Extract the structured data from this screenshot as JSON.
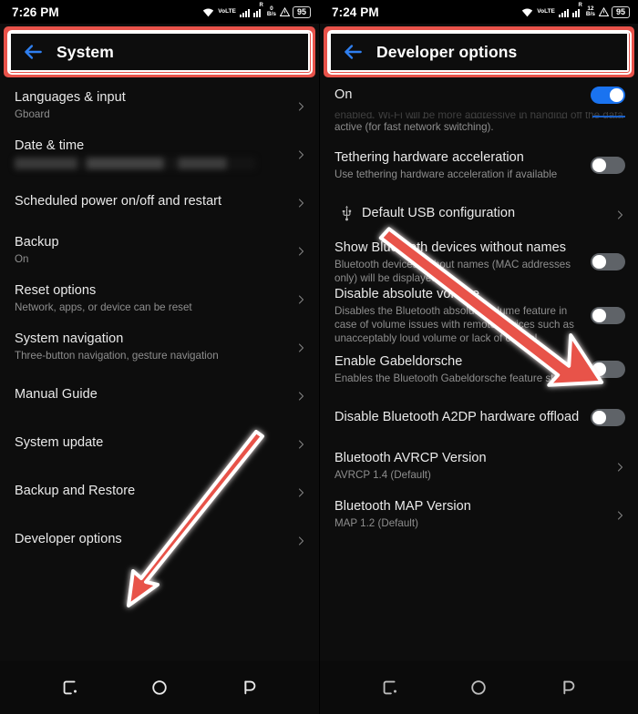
{
  "left_screen": {
    "status_bar": {
      "time": "7:26 PM",
      "volte_label_top": "Vo",
      "volte_label_bottom": "LTE",
      "roaming_label": "R",
      "net_speed_value": "0",
      "net_speed_unit": "B/s",
      "battery_level": "95",
      "icons": [
        "wifi-icon",
        "volte-icon",
        "signal-bars-icon",
        "roaming-signal-icon",
        "network-speed-icon",
        "alert-triangle-icon",
        "battery-icon"
      ]
    },
    "title": "System",
    "back_icon": "back-arrow-icon",
    "items": [
      {
        "title": "Languages & input",
        "subtitle": "Gboard",
        "accessory": "chevron"
      },
      {
        "title": "Date & time",
        "subtitle": "",
        "subtitle_redacted": true,
        "accessory": "chevron"
      },
      {
        "title": "Scheduled power on/off and restart",
        "subtitle": "",
        "accessory": "chevron"
      },
      {
        "title": "Backup",
        "subtitle": "On",
        "accessory": "chevron"
      },
      {
        "title": "Reset options",
        "subtitle": "Network, apps, or device can be reset",
        "accessory": "chevron"
      },
      {
        "title": "System navigation",
        "subtitle": "Three-button navigation, gesture navigation",
        "accessory": "chevron"
      },
      {
        "title": "Manual Guide",
        "subtitle": "",
        "accessory": "chevron"
      },
      {
        "title": "System update",
        "subtitle": "",
        "accessory": "chevron"
      },
      {
        "title": "Backup and Restore",
        "subtitle": "",
        "accessory": "chevron"
      },
      {
        "title": "Developer options",
        "subtitle": "",
        "accessory": "chevron"
      }
    ],
    "nav_bar": [
      "recents-button",
      "home-button",
      "back-button"
    ]
  },
  "right_screen": {
    "status_bar": {
      "time": "7:24 PM",
      "volte_label_top": "Vo",
      "volte_label_bottom": "LTE",
      "roaming_label": "R",
      "net_speed_value": "12",
      "net_speed_unit": "B/s",
      "battery_level": "95",
      "icons": [
        "wifi-icon",
        "volte-icon",
        "signal-bars-icon",
        "roaming-signal-icon",
        "network-speed-icon",
        "alert-triangle-icon",
        "battery-icon"
      ]
    },
    "title": "Developer options",
    "back_icon": "back-arrow-icon",
    "items": [
      {
        "title": "On",
        "subtitle": "active (for fast network switching).",
        "subtitle_clipped_above": "enabled, Wi-Fi will be more aggressive in handing off the data connection to cellular, when Wi-Fi signal is low. Keeps mobile data",
        "accessory": "toggle",
        "toggle": "on"
      },
      {
        "title": "Tethering hardware acceleration",
        "subtitle": "Use tethering hardware acceleration if available",
        "accessory": "toggle",
        "toggle": "off"
      },
      {
        "title": "Default USB configuration",
        "subtitle": "",
        "accessory": "chevron",
        "lead_icon": "usb-icon"
      },
      {
        "title": "Show Bluetooth devices without names",
        "subtitle": "Bluetooth devices without names (MAC addresses only) will be displayed",
        "accessory": "toggle",
        "toggle": "off"
      },
      {
        "title": "Disable absolute volume",
        "subtitle": "Disables the Bluetooth absolute volume feature in case of volume issues with remote devices such as unacceptably loud volume or lack of control.",
        "accessory": "toggle",
        "toggle": "off"
      },
      {
        "title": "Enable Gabeldorsche",
        "subtitle": "Enables the Bluetooth Gabeldorsche feature stack.",
        "accessory": "toggle",
        "toggle": "off"
      },
      {
        "title": "Disable Bluetooth A2DP hardware offload",
        "subtitle": "",
        "accessory": "toggle",
        "toggle": "off"
      },
      {
        "title": "Bluetooth AVRCP Version",
        "subtitle": "AVRCP 1.4 (Default)",
        "accessory": "chevron"
      },
      {
        "title": "Bluetooth MAP Version",
        "subtitle": "MAP 1.2 (Default)",
        "accessory": "chevron"
      }
    ],
    "nav_bar": [
      "recents-button",
      "home-button",
      "back-button"
    ]
  },
  "annotations": {
    "highlight_color": "#e8524a",
    "highlight_outline_color": "#ffffff",
    "arrow_color": "#e8524a",
    "left_arrow_target": "Developer options",
    "right_arrow_target": "Disable absolute volume toggle"
  },
  "colors": {
    "background": "#0d0d0d",
    "toggle_on": "#1a73f0",
    "toggle_off": "#5f6368",
    "accent_blue": "#2f7ff0",
    "title_text": "#ffffff",
    "subtitle_text": "#8e8e8e"
  }
}
